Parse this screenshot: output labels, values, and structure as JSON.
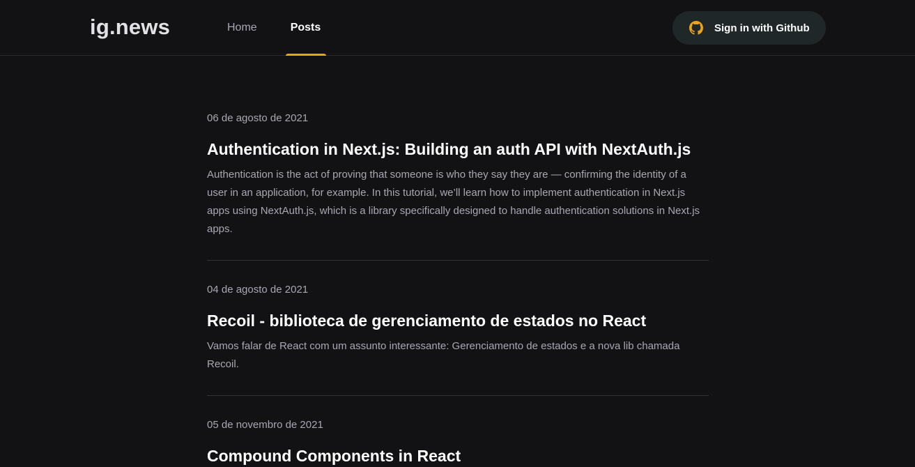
{
  "header": {
    "logo": "ig.news",
    "nav": [
      {
        "label": "Home",
        "active": false
      },
      {
        "label": "Posts",
        "active": true
      }
    ],
    "signin_label": "Sign in with Github",
    "signin_icon": "github-icon",
    "accent_color": "#eba417"
  },
  "posts": [
    {
      "date": "06 de agosto de 2021",
      "title": "Authentication in Next.js: Building an auth API with NextAuth.js",
      "excerpt": "Authentication is the act of proving that someone is who they say they are — confirming the identity of a user in an application, for example. In this tutorial, we’ll learn how to implement authentication in Next.js apps using NextAuth.js, which is a library specifically designed to handle authentication solutions in Next.js apps."
    },
    {
      "date": "04 de agosto de 2021",
      "title": "Recoil - biblioteca de gerenciamento de estados no React",
      "excerpt": "Vamos falar de React com um assunto interessante: Gerenciamento de estados e a nova lib chamada Recoil."
    },
    {
      "date": "05 de novembro de 2021",
      "title": "Compound Components in React",
      "excerpt": ""
    }
  ]
}
